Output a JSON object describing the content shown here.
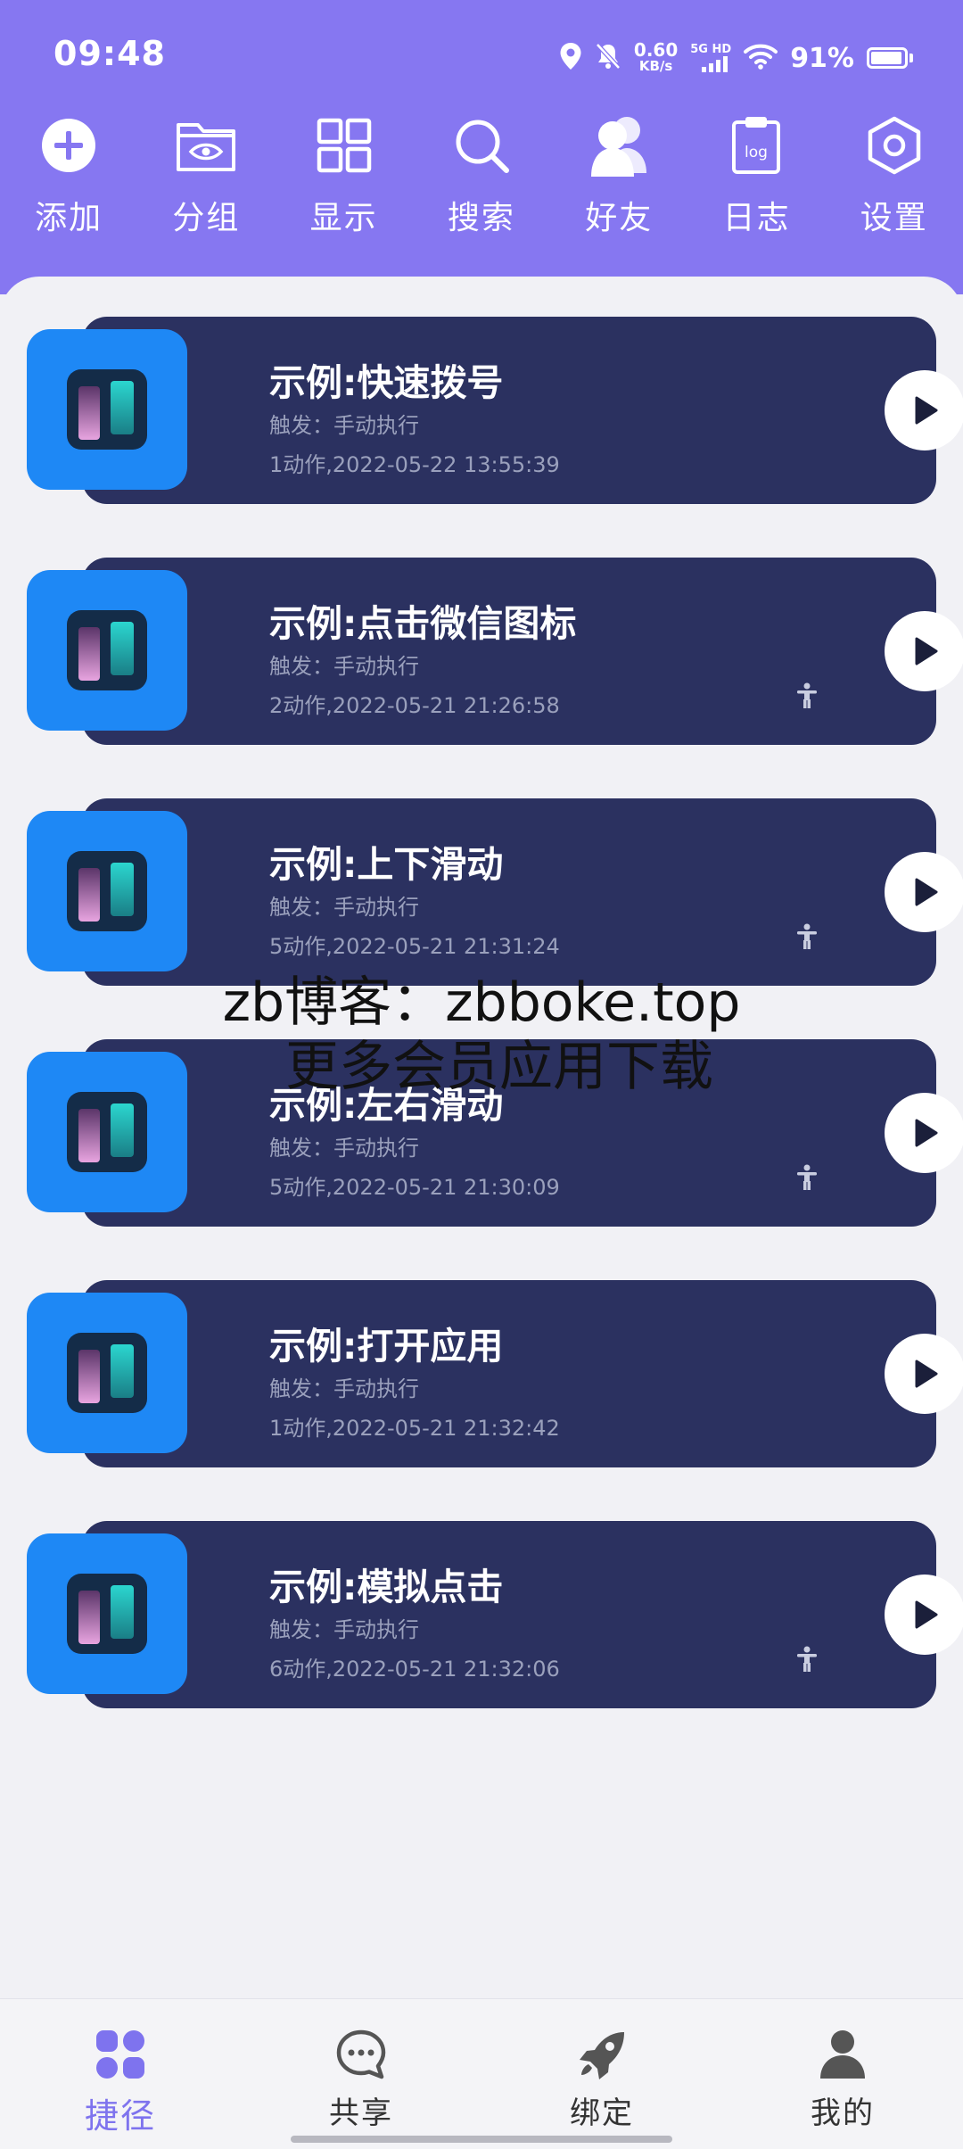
{
  "status_bar": {
    "time": "09:48",
    "net_speed_value": "0.60",
    "net_speed_unit": "KB/s",
    "signal_label": "5G HD",
    "battery_percent": "91%",
    "icons": [
      "location-icon",
      "mute-icon",
      "signal-icon",
      "wifi-icon",
      "battery-icon"
    ]
  },
  "toolbar": {
    "items": [
      {
        "label": "添加",
        "icon": "add-circle-icon"
      },
      {
        "label": "分组",
        "icon": "folder-eye-icon"
      },
      {
        "label": "显示",
        "icon": "grid-icon"
      },
      {
        "label": "搜索",
        "icon": "search-icon"
      },
      {
        "label": "好友",
        "icon": "friends-icon"
      },
      {
        "label": "日志",
        "icon": "log-icon"
      },
      {
        "label": "设置",
        "icon": "settings-hex-icon"
      }
    ]
  },
  "shortcuts": [
    {
      "title": "示例:快速拨号",
      "trigger": "触发：手动执行",
      "meta": "1动作,2022-05-22 13:55:39",
      "accessibility": false
    },
    {
      "title": "示例:点击微信图标",
      "trigger": "触发：手动执行",
      "meta": "2动作,2022-05-21 21:26:58",
      "accessibility": true
    },
    {
      "title": "示例:上下滑动",
      "trigger": "触发：手动执行",
      "meta": "5动作,2022-05-21 21:31:24",
      "accessibility": true
    },
    {
      "title": "示例:左右滑动",
      "trigger": "触发：手动执行",
      "meta": "5动作,2022-05-21 21:30:09",
      "accessibility": true
    },
    {
      "title": "示例:打开应用",
      "trigger": "触发：手动执行",
      "meta": "1动作,2022-05-21 21:32:42",
      "accessibility": false
    },
    {
      "title": "示例:模拟点击",
      "trigger": "触发：手动执行",
      "meta": "6动作,2022-05-21 21:32:06",
      "accessibility": true
    }
  ],
  "watermark": {
    "line1": "zb博客：zbboke.top",
    "line2": "更多会员应用下载"
  },
  "bottom_nav": {
    "items": [
      {
        "label": "捷径",
        "icon": "shortcuts-icon",
        "active": true
      },
      {
        "label": "共享",
        "icon": "chat-bubble-icon",
        "active": false
      },
      {
        "label": "绑定",
        "icon": "rocket-icon",
        "active": false
      },
      {
        "label": "我的",
        "icon": "user-icon",
        "active": false
      }
    ]
  },
  "colors": {
    "header_bg": "#8677f1",
    "card_bg": "#2b3160",
    "app_icon_bg": "#1e88f5",
    "active_nav": "#7e73ee"
  }
}
